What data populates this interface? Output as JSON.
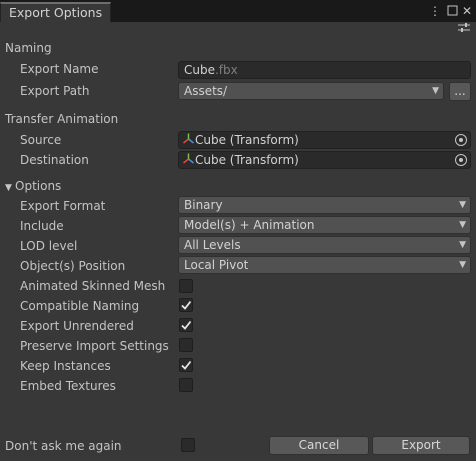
{
  "window": {
    "tab_title": "Export Options",
    "menu_icon": "kebab-menu-icon",
    "close_icon": "close-icon",
    "presets_icon": "preset-sliders-icon"
  },
  "naming": {
    "heading": "Naming",
    "export_name_label": "Export Name",
    "export_name_value": "Cube",
    "export_name_ext": ".fbx",
    "export_path_label": "Export Path",
    "export_path_value": "Assets/",
    "browse_label": "..."
  },
  "transfer": {
    "heading": "Transfer Animation",
    "source_label": "Source",
    "source_value": "Cube (Transform)",
    "destination_label": "Destination",
    "destination_value": "Cube (Transform)"
  },
  "options": {
    "heading": "Options",
    "export_format_label": "Export Format",
    "export_format_value": "Binary",
    "include_label": "Include",
    "include_value": "Model(s) + Animation",
    "lod_label": "LOD level",
    "lod_value": "All Levels",
    "position_label": "Object(s) Position",
    "position_value": "Local Pivot",
    "toggles": [
      {
        "label": "Animated Skinned Mesh",
        "checked": false
      },
      {
        "label": "Compatible Naming",
        "checked": true
      },
      {
        "label": "Export Unrendered",
        "checked": true
      },
      {
        "label": "Preserve Import Settings",
        "checked": false
      },
      {
        "label": "Keep Instances",
        "checked": true
      },
      {
        "label": "Embed Textures",
        "checked": false
      }
    ]
  },
  "footer": {
    "dont_ask_label": "Don't ask me again",
    "dont_ask_checked": false,
    "cancel_label": "Cancel",
    "export_label": "Export"
  }
}
